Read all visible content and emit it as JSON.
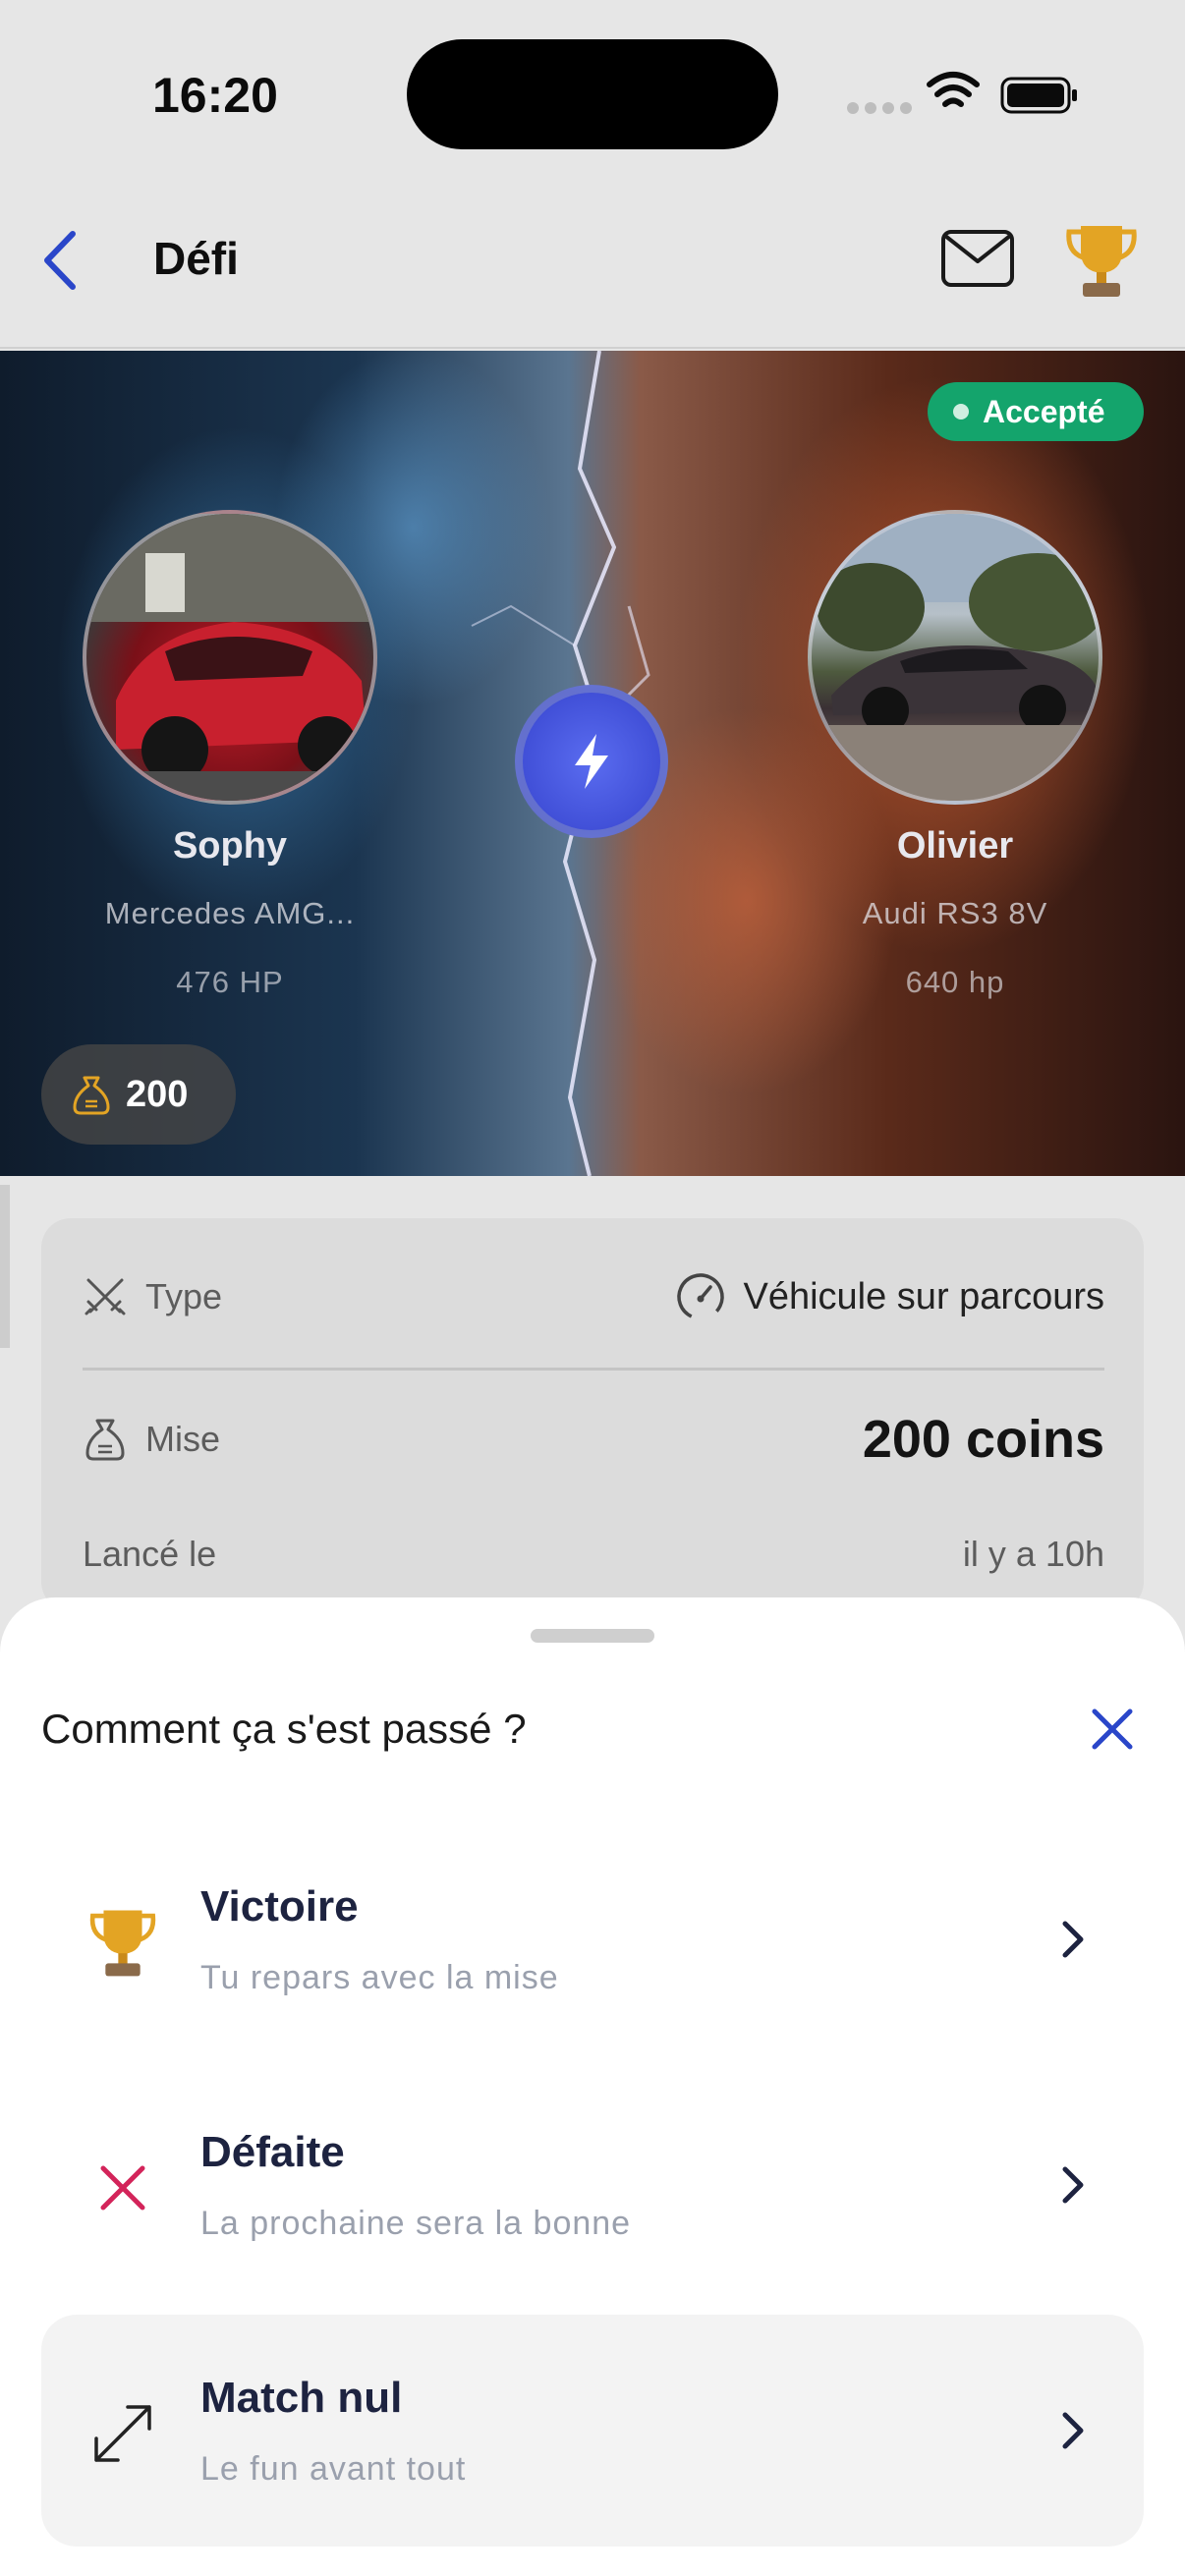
{
  "status_bar": {
    "time": "16:20"
  },
  "nav": {
    "title": "Défi"
  },
  "hero": {
    "status_badge": "Accepté",
    "stake": "200",
    "players": [
      {
        "name": "Sophy",
        "car": "Mercedes AMG...",
        "power": "476 HP"
      },
      {
        "name": "Olivier",
        "car": "Audi RS3 8V",
        "power": "640 hp"
      }
    ]
  },
  "details": {
    "type_label": "Type",
    "type_value": "Véhicule sur parcours",
    "stake_label": "Mise",
    "stake_value": "200 coins",
    "launched_label": "Lancé le",
    "launched_value": "il y a 10h"
  },
  "sheet": {
    "title": "Comment ça s'est passé ?",
    "options": [
      {
        "title": "Victoire",
        "subtitle": "Tu repars avec la mise",
        "icon": "trophy-icon"
      },
      {
        "title": "Défaite",
        "subtitle": "La prochaine sera la bonne",
        "icon": "cross-icon"
      },
      {
        "title": "Match nul",
        "subtitle": "Le fun avant tout",
        "icon": "expand-arrows-icon"
      }
    ]
  },
  "colors": {
    "accent": "#3b4fd4",
    "badge": "#14a46c",
    "defeat": "#d3245a",
    "trophy": "#e3a424"
  }
}
